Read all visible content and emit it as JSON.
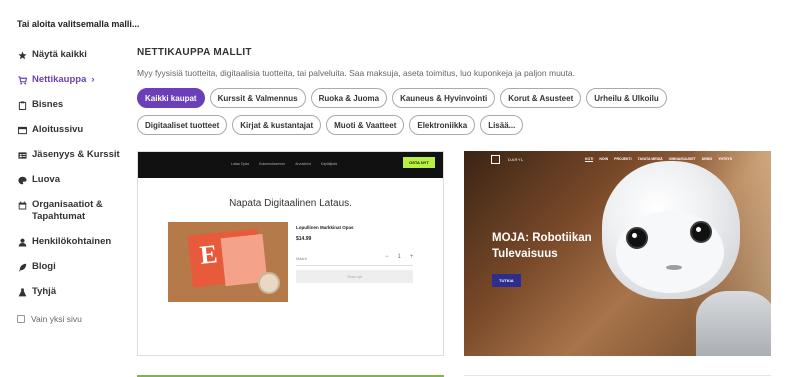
{
  "top_title": "Tai aloita valitsemalla malli...",
  "sidebar": {
    "items": [
      {
        "label": "Näytä kaikki",
        "icon": "star-icon",
        "active": false
      },
      {
        "label": "Nettikauppa",
        "icon": "cart-icon",
        "active": true,
        "arrow": "›"
      },
      {
        "label": "Bisnes",
        "icon": "clipboard-icon",
        "active": false
      },
      {
        "label": "Aloitussivu",
        "icon": "browser-icon",
        "active": false
      },
      {
        "label": "Jäsenyys & Kurssit",
        "icon": "id-card-icon",
        "active": false
      },
      {
        "label": "Luova",
        "icon": "palette-icon",
        "active": false
      },
      {
        "label": "Organisaatiot & Tapahtumat",
        "icon": "calendar-icon",
        "active": false
      },
      {
        "label": "Henkilökohtainen",
        "icon": "person-icon",
        "active": false
      },
      {
        "label": "Blogi",
        "icon": "feather-icon",
        "active": false
      },
      {
        "label": "Tyhjä",
        "icon": "flask-icon",
        "active": false
      }
    ],
    "checkbox_label": "Vain yksi sivu"
  },
  "main": {
    "section_title": "NETTIKAUPPA MALLIT",
    "section_desc": "Myy fyysisiä tuotteita, digitaalisia tuotteita, tai palveluita. Saa maksuja, aseta toimitus, luo kuponkeja ja paljon muuta.",
    "chips": [
      {
        "label": "Kaikki kaupat",
        "active": true
      },
      {
        "label": "Kurssit & Valmennus",
        "active": false
      },
      {
        "label": "Ruoka & Juoma",
        "active": false
      },
      {
        "label": "Kauneus & Hyvinvointi",
        "active": false
      },
      {
        "label": "Korut & Asusteet",
        "active": false
      },
      {
        "label": "Urheilu & Ulkoilu",
        "active": false
      },
      {
        "label": "Digitaaliset tuotteet",
        "active": false
      },
      {
        "label": "Kirjat & kustantajat",
        "active": false
      },
      {
        "label": "Muoti & Vaatteet",
        "active": false
      },
      {
        "label": "Elektroniikka",
        "active": false
      },
      {
        "label": "Lisää...",
        "active": false
      }
    ]
  },
  "card1": {
    "nav_links": [
      "Lataa Opas",
      "Kokemuksemme",
      "Arvostelut",
      "Käyttäjistä"
    ],
    "buy_label": "OSTA NYT",
    "heading": "Napata Digitaalinen Lataus.",
    "book_letter": "E",
    "product_title": "Lopullinen Markkinat Opas",
    "price": "$14.99",
    "qty_label": "Määrä",
    "qty_minus": "−",
    "qty_value": "1",
    "qty_plus": "+",
    "cart_label": "Tilaa nyt"
  },
  "card2": {
    "brand": "DARYL",
    "nav_links": [
      "KOTI",
      "NOIN",
      "PROJEKTI",
      "TAVATA MEIDÄ",
      "OMINAISUUDET",
      "DEMO",
      "YHTEYS"
    ],
    "title": "MOJA: Robotiikan Tulevaisuus",
    "button": "TUTKIA"
  }
}
